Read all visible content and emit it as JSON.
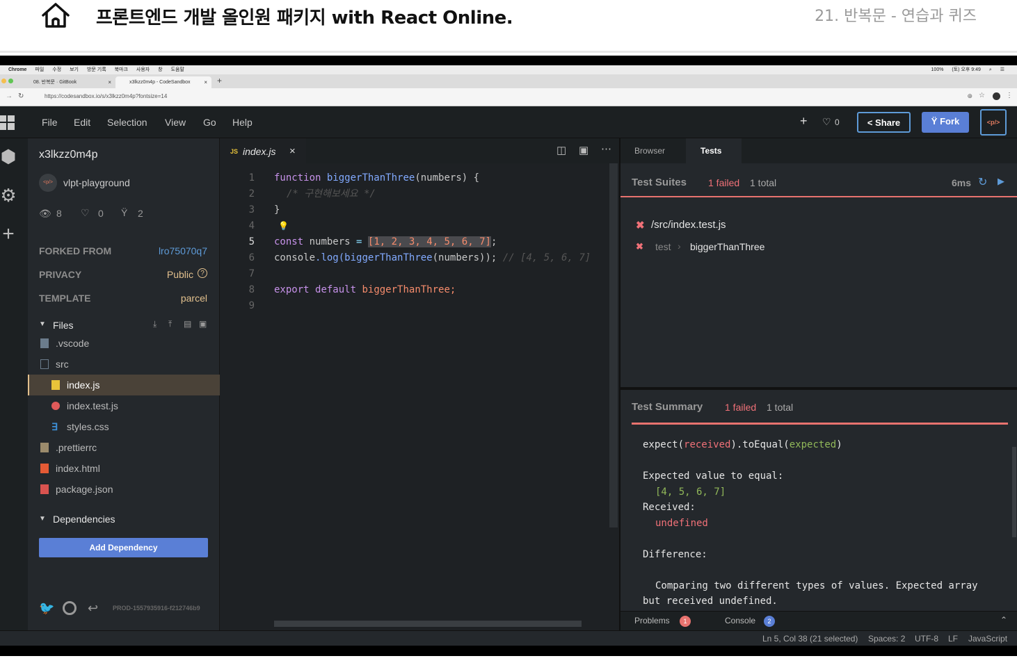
{
  "course_header": {
    "title": "프론트엔드 개발 올인원 패키지 with React Online.",
    "chapter": "21. 반복문 - 연습과 퀴즈"
  },
  "mac_menu": [
    "Chrome",
    "파일",
    "수정",
    "보기",
    "방문 기록",
    "북마크",
    "사용자",
    "창",
    "도움말"
  ],
  "mac_status": {
    "battery": "100%",
    "clock": "(토) 오후 9:49"
  },
  "browser": {
    "tabs": [
      {
        "label": "08. 반복문 · GitBook"
      },
      {
        "label": "x3lkzz0m4p - CodeSandbox"
      }
    ],
    "new_tab": "+",
    "url": "https://codesandbox.io/s/x3lkzz0m4p?fontsize=14"
  },
  "menubar": {
    "items": [
      "File",
      "Edit",
      "Selection",
      "View",
      "Go",
      "Help"
    ],
    "plus": "+",
    "likes": "0",
    "share": "Share",
    "fork": "Fork",
    "embed": "<p/>"
  },
  "sandbox": {
    "name": "x3lkzz0m4p",
    "template_badge": "<p/>",
    "template_name": "vlpt-playground",
    "views": "8",
    "likes": "0",
    "forks": "2"
  },
  "meta": [
    {
      "label": "FORKED FROM",
      "value": "lro75070q7"
    },
    {
      "label": "PRIVACY",
      "value": "Public"
    },
    {
      "label": "TEMPLATE",
      "value": "parcel"
    }
  ],
  "files_header": "Files",
  "files": [
    {
      "name": ".vscode",
      "color": "#6b7c8c",
      "indent": 0
    },
    {
      "name": "src",
      "color": "#6b7c8c",
      "indent": 0
    },
    {
      "name": "index.js",
      "color": "#e8c33a",
      "indent": 1
    },
    {
      "name": "index.test.js",
      "color": "#e05a5a",
      "indent": 1
    },
    {
      "name": "styles.css",
      "color": "#3d8fd6",
      "indent": 1
    },
    {
      "name": ".prettierrc",
      "color": "#9b8b6c",
      "indent": 0
    },
    {
      "name": "index.html",
      "color": "#e45a35",
      "indent": 0
    },
    {
      "name": "package.json",
      "color": "#d9534f",
      "indent": 0
    }
  ],
  "deps_header": "Dependencies",
  "add_dependency": "Add Dependency",
  "build_id": "PROD-1557935916-f212746b9",
  "editor": {
    "tab": "index.js",
    "tab_badge": "JS",
    "lines": [
      "1",
      "2",
      "3",
      "4",
      "5",
      "6",
      "7",
      "8",
      "9"
    ]
  },
  "code": {
    "l1": {
      "a": "function",
      "b": "biggerThanThree",
      "c": "(numbers) {"
    },
    "l2": "/* 구현해보세요 */",
    "l3": "}",
    "l5": {
      "a": "const",
      "b": "numbers",
      "c": "=",
      "d": "[1, 2, 3, 4, 5, 6, 7]",
      "e": ";"
    },
    "l6": {
      "a": "console",
      "b": ".log(",
      "c": "biggerThanThree",
      "d": "(numbers));",
      "e": "// [4, 5, 6, 7]"
    },
    "l8": {
      "a": "export",
      "b": "default",
      "c": "biggerThanThree;"
    }
  },
  "panel": {
    "tab_browser": "Browser",
    "tab_tests": "Tests",
    "suites_label": "Test Suites",
    "failed": "1 failed",
    "total": "1 total",
    "time": "6ms",
    "test_file": "/src/index.test.js",
    "test_kind": "test",
    "test_name": "biggerThanThree",
    "summary_label": "Test Summary"
  },
  "summary": {
    "a": "expect(",
    "b": "received",
    "c": ").toEqual(",
    "d": "expected",
    "e": ")",
    "f": "Expected value to equal:",
    "g": "[4, 5, 6, 7]",
    "h": "Received:",
    "i": "undefined",
    "j": "Difference:",
    "k": "Comparing two different types of values. Expected array",
    "l": "but received undefined."
  },
  "bottom": {
    "problems": "Problems",
    "problems_count": "1",
    "console": "Console",
    "console_count": "2"
  },
  "status": {
    "position": "Ln 5, Col 38 (21 selected)",
    "spaces": "Spaces: 2",
    "encoding": "UTF-8",
    "eol": "LF",
    "language": "JavaScript"
  }
}
